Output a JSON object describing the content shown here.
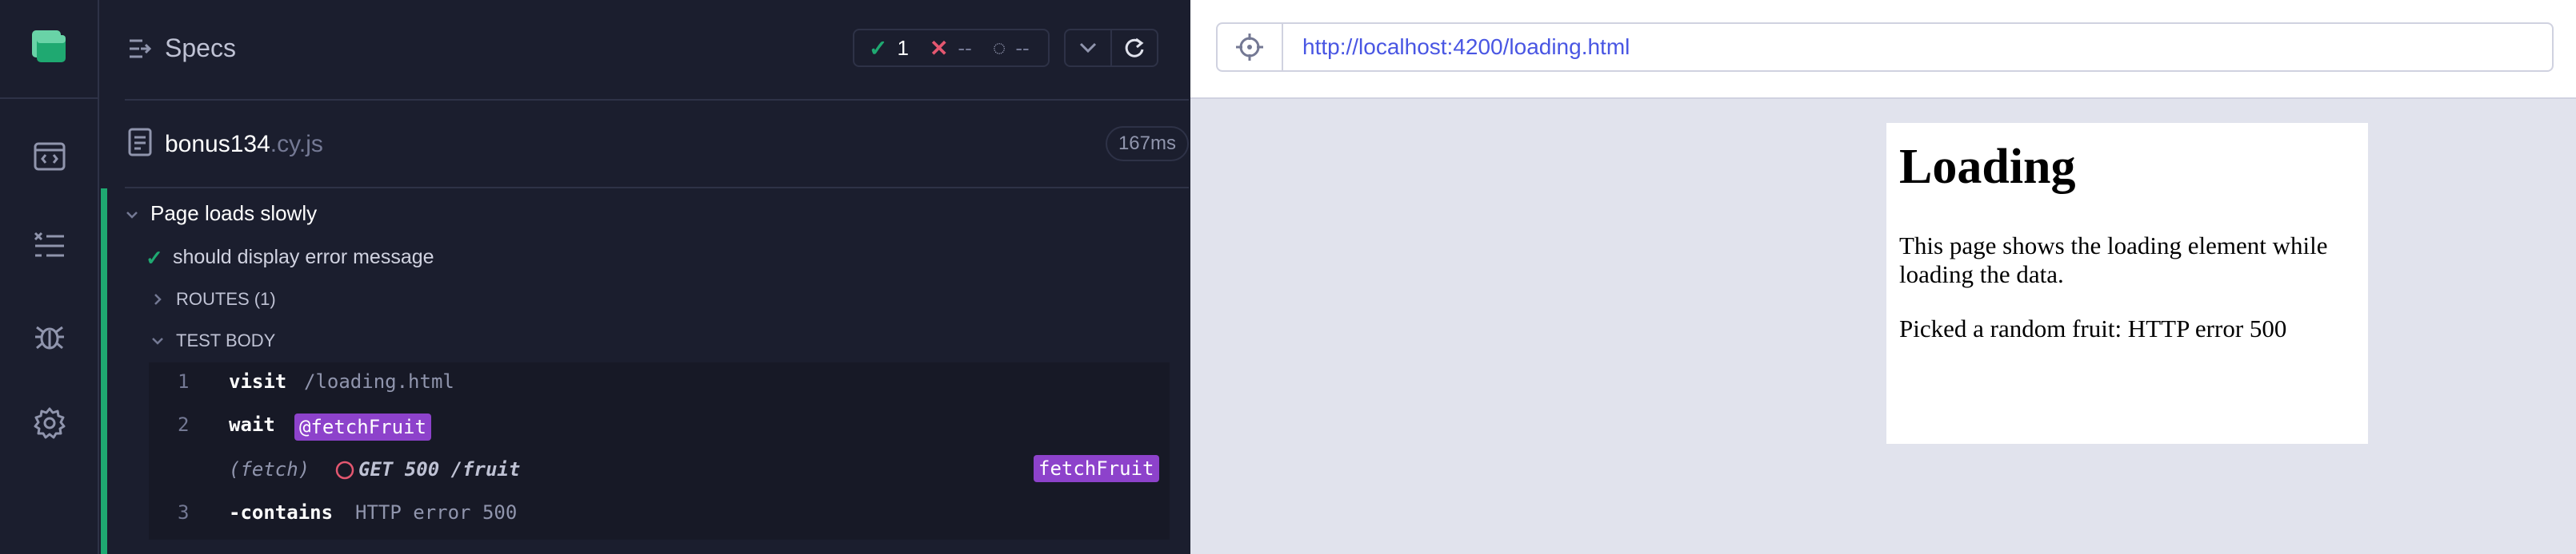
{
  "reporter": {
    "header_title": "Specs",
    "stats": {
      "passed": "1",
      "failed": "--",
      "pending": "--"
    },
    "file": {
      "name": "bonus134",
      "ext": ".cy.js",
      "duration": "167ms"
    },
    "suite_title": "Page loads slowly",
    "test_title": "should display error message",
    "routes_label": "ROUTES (1)",
    "test_body_label": "TEST BODY",
    "commands": [
      {
        "num": "1",
        "name": "visit",
        "message": "/loading.html"
      },
      {
        "num": "2",
        "name": "wait",
        "alias": "@fetchFruit"
      },
      {
        "name": "(fetch)",
        "message": "GET 500 /fruit",
        "alias": "fetchFruit"
      },
      {
        "num": "3",
        "name": "-contains",
        "message": "HTTP error 500"
      }
    ]
  },
  "aut": {
    "url": "http://localhost:4200/loading.html",
    "page": {
      "heading": "Loading",
      "paragraph1": "This page shows the loading element while loading the data.",
      "paragraph2": "Picked a random fruit: HTTP error 500"
    }
  },
  "colors": {
    "pass": "#1fa971",
    "fail": "#e45770",
    "alias": "#8d42cb",
    "link": "#4956e3"
  }
}
